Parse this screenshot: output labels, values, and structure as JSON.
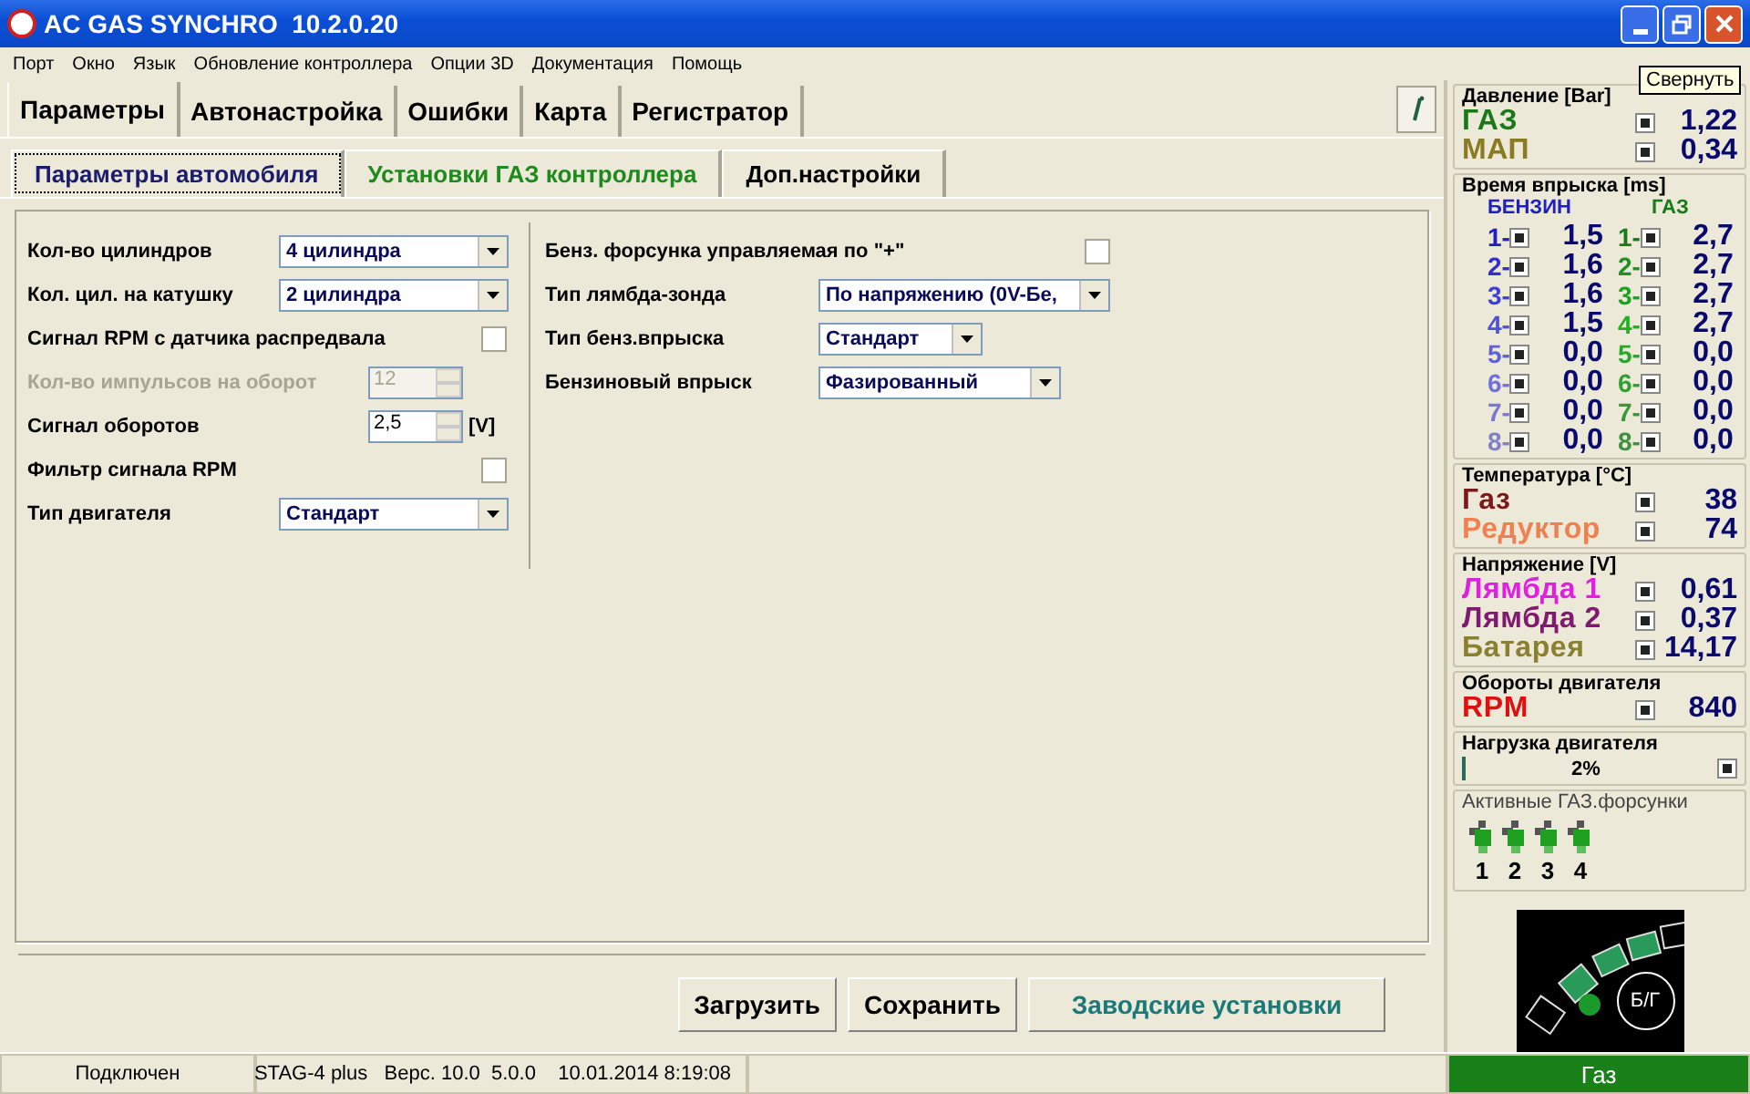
{
  "window": {
    "title": "AC GAS SYNCHRO  10.2.0.20",
    "tooltip": "Свернуть"
  },
  "menu": [
    "Порт",
    "Окно",
    "Язык",
    "Обновление контроллера",
    "Опции 3D",
    "Документация",
    "Помощь"
  ],
  "main_tabs": [
    {
      "label": "Параметры",
      "selected": true
    },
    {
      "label": "Автонастройка",
      "selected": false
    },
    {
      "label": "Ошибки",
      "selected": false
    },
    {
      "label": "Карта",
      "selected": false
    },
    {
      "label": "Регистратор",
      "selected": false
    }
  ],
  "sub_tabs": [
    {
      "label": "Параметры автомобиля",
      "selected": true,
      "color": "#1c1c6e"
    },
    {
      "label": "Установки ГАЗ контроллера",
      "selected": false,
      "color": "#1e8a1e"
    },
    {
      "label": "Доп.настройки",
      "selected": false,
      "color": "#000000"
    }
  ],
  "left_settings": [
    {
      "kind": "combo",
      "label": "Кол-во цилиндров",
      "value": "4 цилиндра"
    },
    {
      "kind": "combo",
      "label": "Кол. цил. на катушку",
      "value": "2 цилиндра"
    },
    {
      "kind": "checkbox",
      "label": "Сигнал RPM с датчика распредвала",
      "checked": false
    },
    {
      "kind": "spin",
      "label": "Кол-во импульсов на оборот",
      "value": "12",
      "disabled": true
    },
    {
      "kind": "spin",
      "label": "Сигнал оборотов",
      "value": "2,5",
      "unit": "[V]",
      "disabled": false
    },
    {
      "kind": "checkbox",
      "label": "Фильтр сигнала RPM",
      "checked": false
    },
    {
      "kind": "combo",
      "label": "Тип двигателя",
      "value": "Стандарт"
    }
  ],
  "right_settings": [
    {
      "kind": "checkbox",
      "label": "Бенз. форсунка управляемая по \"+\"",
      "checked": false
    },
    {
      "kind": "combo",
      "label": "Тип лямбда-зонда",
      "value": "По напряжению  (0V-Бе,"
    },
    {
      "kind": "combo",
      "label": "Тип бенз.впрыска",
      "value": "Стандарт"
    },
    {
      "kind": "combo",
      "label": "Бензиновый впрыск",
      "value": "Фазированный"
    }
  ],
  "buttons": [
    {
      "label": "Загрузить",
      "color": "#000000"
    },
    {
      "label": "Сохранить",
      "color": "#000000"
    },
    {
      "label": "Заводские установки",
      "color": "#1a7a7a"
    }
  ],
  "pressure": {
    "title": "Давление [Bar]",
    "rows": [
      {
        "label": "ГАЗ",
        "color": "#1a7a1a",
        "checked": true,
        "value": "1,22"
      },
      {
        "label": "МАП",
        "color": "#8a7a20",
        "checked": true,
        "value": "0,34"
      }
    ]
  },
  "injection": {
    "title": "Время впрыска [ms]",
    "petrol_header": "БЕНЗИН",
    "gas_header": "ГАЗ",
    "rows": [
      {
        "petrol": {
          "label": "1-",
          "color": "#2020c0",
          "checked": true,
          "value": "1,5"
        },
        "gas": {
          "label": "1-",
          "color": "#1a7a1a",
          "checked": true,
          "value": "2,7"
        }
      },
      {
        "petrol": {
          "label": "2-",
          "color": "#3030d0",
          "checked": true,
          "value": "1,6"
        },
        "gas": {
          "label": "2-",
          "color": "#209020",
          "checked": true,
          "value": "2,7"
        }
      },
      {
        "petrol": {
          "label": "3-",
          "color": "#4040d8",
          "checked": true,
          "value": "1,6"
        },
        "gas": {
          "label": "3-",
          "color": "#20a020",
          "checked": true,
          "value": "2,7"
        }
      },
      {
        "petrol": {
          "label": "4-",
          "color": "#5050d8",
          "checked": true,
          "value": "1,5"
        },
        "gas": {
          "label": "4-",
          "color": "#20b020",
          "checked": true,
          "value": "2,7"
        }
      },
      {
        "petrol": {
          "label": "5-",
          "color": "#6060d8",
          "checked": true,
          "value": "0,0"
        },
        "gas": {
          "label": "5-",
          "color": "#28a828",
          "checked": true,
          "value": "0,0"
        }
      },
      {
        "petrol": {
          "label": "6-",
          "color": "#7070d8",
          "checked": true,
          "value": "0,0"
        },
        "gas": {
          "label": "6-",
          "color": "#30a030",
          "checked": true,
          "value": "0,0"
        }
      },
      {
        "petrol": {
          "label": "7-",
          "color": "#7878d0",
          "checked": true,
          "value": "0,0"
        },
        "gas": {
          "label": "7-",
          "color": "#389838",
          "checked": true,
          "value": "0,0"
        }
      },
      {
        "petrol": {
          "label": "8-",
          "color": "#8080c8",
          "checked": true,
          "value": "0,0"
        },
        "gas": {
          "label": "8-",
          "color": "#409040",
          "checked": true,
          "value": "0,0"
        }
      }
    ]
  },
  "temperature": {
    "title": "Температура  [°C]",
    "rows": [
      {
        "label": "Газ",
        "color": "#7a1a1a",
        "checked": true,
        "value": "38"
      },
      {
        "label": "Редуктор",
        "color": "#f08050",
        "checked": true,
        "value": "74"
      }
    ]
  },
  "voltage": {
    "title": "Напряжение [V]",
    "rows": [
      {
        "label": "Лямбда 1",
        "color": "#e020e0",
        "checked": true,
        "value": "0,61"
      },
      {
        "label": "Лямбда 2",
        "color": "#801a70",
        "checked": true,
        "value": "0,37"
      },
      {
        "label": "Батарея",
        "color": "#8a8030",
        "checked": true,
        "value": "14,17"
      }
    ]
  },
  "rpm": {
    "title": "Обороты двигателя",
    "rows": [
      {
        "label": "RPM",
        "color": "#e01010",
        "checked": true,
        "value": "840"
      }
    ]
  },
  "load": {
    "title": "Нагрузка двигателя",
    "reading": "2%",
    "level": 0.02,
    "checked": true
  },
  "active_injectors": {
    "title": "Активные ГАЗ.форсунки",
    "items": [
      {
        "label": "1",
        "active": true
      },
      {
        "label": "2",
        "active": true
      },
      {
        "label": "3",
        "active": true
      },
      {
        "label": "4",
        "active": true
      }
    ]
  },
  "gauge": {
    "label": "Б/Г",
    "segments": [
      {
        "filled": false
      },
      {
        "filled": true
      },
      {
        "filled": true
      },
      {
        "filled": true
      },
      {
        "filled": false
      }
    ],
    "gas_led_on": true
  },
  "status_bar": {
    "connection": "Подключен",
    "device": "STAG-4 plus   Верс. 10.0  5.0.0    10.01.2014 8:19:08",
    "fuel": "Газ"
  }
}
